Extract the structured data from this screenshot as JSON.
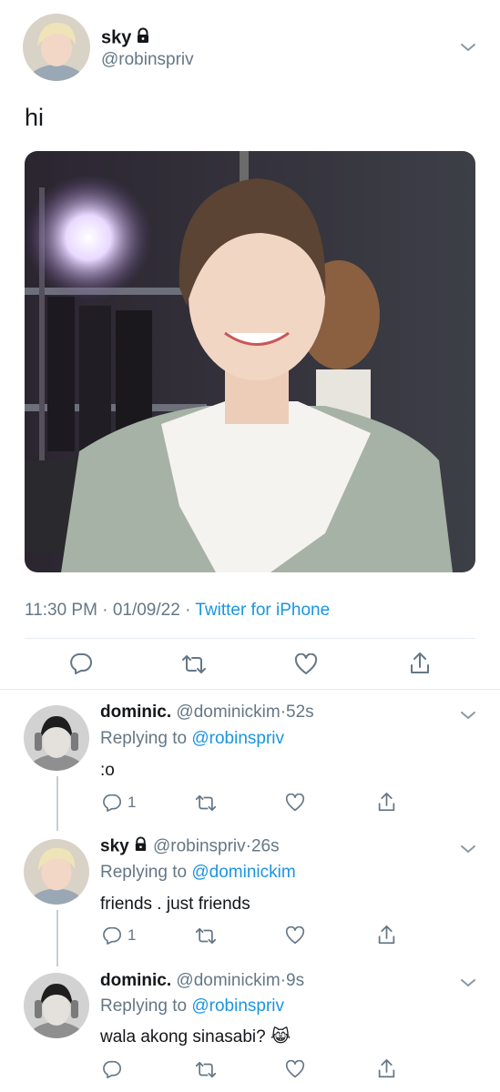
{
  "main_tweet": {
    "display_name": "sky",
    "handle": "@robinspriv",
    "text": "hi",
    "time": "11:30 PM",
    "date": "01/09/22",
    "separator": "·",
    "client": "Twitter for iPhone"
  },
  "replies": [
    {
      "display_name": "dominic.",
      "handle": "@dominickim",
      "separator": "·",
      "time_ago": "52s",
      "replying_prefix": "Replying to",
      "replying_to": "@robinspriv",
      "text": ":o",
      "reply_count": "1"
    },
    {
      "display_name": "sky",
      "handle": "@robinspriv",
      "separator": "·",
      "time_ago": "26s",
      "replying_prefix": "Replying to",
      "replying_to": "@dominickim",
      "text": "friends . just friends",
      "reply_count": "1"
    },
    {
      "display_name": "dominic.",
      "handle": "@dominickim",
      "separator": "·",
      "time_ago": "9s",
      "replying_prefix": "Replying to",
      "replying_to": "@robinspriv",
      "text": "wala akong sinasabi?",
      "emoji": "😹",
      "reply_count": ""
    }
  ],
  "icons": {
    "reply": "reply-icon",
    "retweet": "retweet-icon",
    "like": "heart-icon",
    "share": "share-icon",
    "lock": "lock-icon",
    "more": "chevron-down-icon"
  },
  "colors": {
    "link": "#1b95e0",
    "secondary_text": "#657786",
    "primary_text": "#14171a",
    "divider": "#e6ecf0"
  }
}
